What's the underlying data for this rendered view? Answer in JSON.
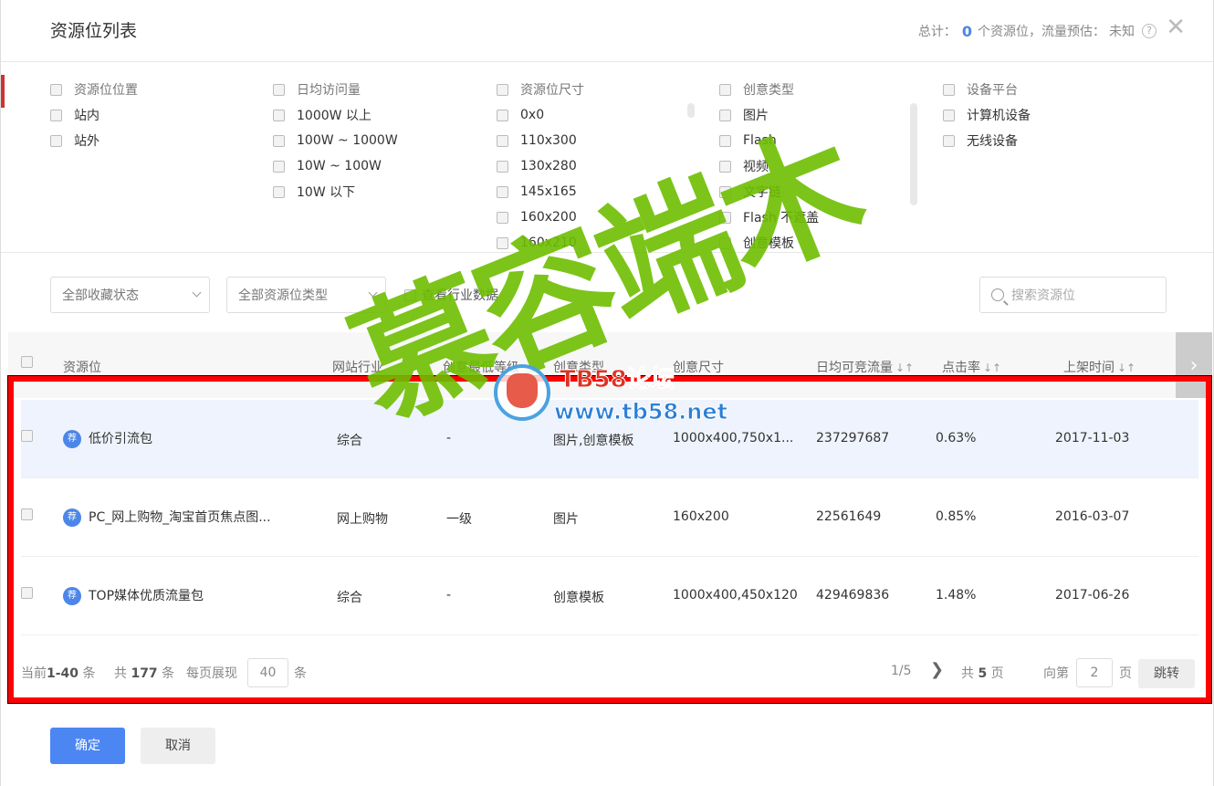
{
  "header": {
    "title": "资源位列表",
    "summary_prefix": "总计：",
    "summary_count": "0",
    "summary_mid": "个资源位，流量预估：",
    "summary_estimate": "未知",
    "help": "?",
    "close": "✕"
  },
  "filters": [
    {
      "head": "资源位位置",
      "items": [
        "站内",
        "站外"
      ]
    },
    {
      "head": "日均访问量",
      "items": [
        "1000W 以上",
        "100W ~ 1000W",
        "10W ~ 100W",
        "10W 以下"
      ]
    },
    {
      "head": "资源位尺寸",
      "items": [
        "0x0",
        "110x300",
        "130x280",
        "145x165",
        "160x200",
        "160x210"
      ]
    },
    {
      "head": "创意类型",
      "items": [
        "图片",
        "Flash",
        "视频",
        "文字链",
        "Flash 不遮盖",
        "创意模板"
      ]
    },
    {
      "head": "设备平台",
      "items": [
        "计算机设备",
        "无线设备"
      ]
    }
  ],
  "toolbar": {
    "collect_status": "全部收藏状态",
    "resource_type": "全部资源位类型",
    "industry_data": "查看行业数据",
    "search_placeholder": "搜索资源位"
  },
  "table": {
    "columns": [
      "资源位",
      "网站行业",
      "创意最低等级",
      "创意类型",
      "创意尺寸",
      "日均可竞流量",
      "点击率",
      "上架时间"
    ],
    "sort_glyph": "↓↑",
    "next": "›",
    "rows": [
      {
        "tag": "荐",
        "name": "低价引流包",
        "industry": "综合",
        "level": "-",
        "type": "图片,创意模板",
        "size": "1000x400,750x1...",
        "traffic": "237297687",
        "ctr": "0.63%",
        "date": "2017-11-03"
      },
      {
        "tag": "荐",
        "name": "PC_网上购物_淘宝首页焦点图...",
        "industry": "网上购物",
        "level": "一级",
        "type": "图片",
        "size": "160x200",
        "traffic": "22561649",
        "ctr": "0.85%",
        "date": "2016-03-07"
      },
      {
        "tag": "荐",
        "name": "TOP媒体优质流量包",
        "industry": "综合",
        "level": "-",
        "type": "创意模板",
        "size": "1000x400,450x120",
        "traffic": "429469836",
        "ctr": "1.48%",
        "date": "2017-06-26"
      }
    ]
  },
  "pager": {
    "current_prefix": "当前",
    "current_range": "1-40",
    "current_suffix": "条",
    "total_prefix": "共",
    "total": "177",
    "total_suffix": "条",
    "per_page_label": "每页展现",
    "per_page": "40",
    "per_page_suffix": "条",
    "page_status": "1/5",
    "pages_prefix": "共",
    "pages": "5",
    "pages_suffix": "页",
    "goto_prefix": "向第",
    "goto_value": "2",
    "goto_suffix": "页",
    "jump": "跳转"
  },
  "footer": {
    "ok": "确定",
    "cancel": "取消"
  },
  "watermark": {
    "text": "慕容端木",
    "logo_top": "TB58论坛",
    "logo_bottom": "www.tb58.net"
  },
  "colors": {
    "accent": "#4c86f3",
    "highlight_row": "#eef3fd",
    "annotation": "#ff0000",
    "watermark": "#6ebe00"
  }
}
